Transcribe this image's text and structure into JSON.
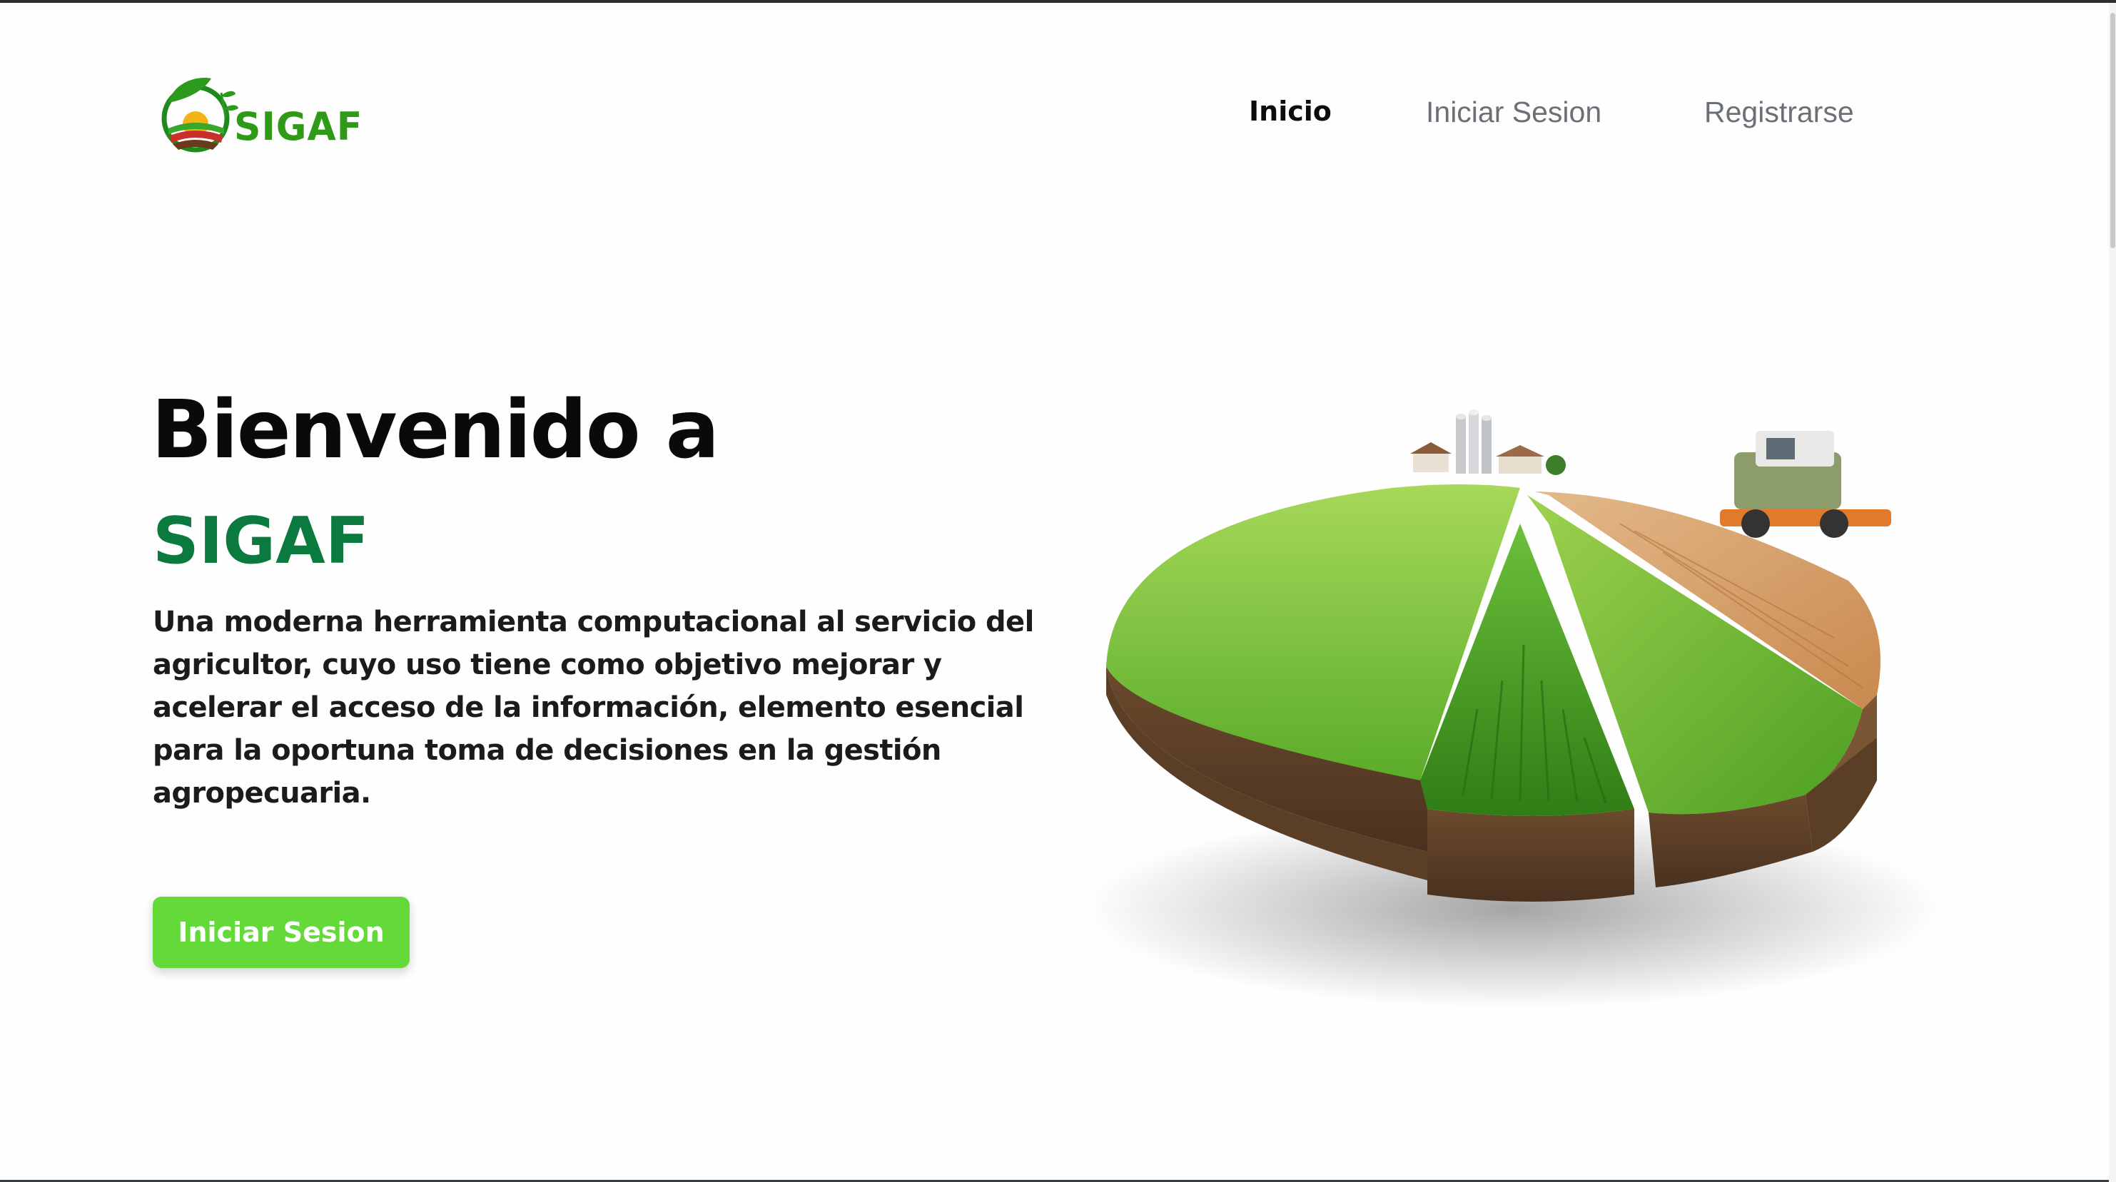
{
  "header": {
    "logo_text": "SIGAF",
    "nav": [
      {
        "label": "Inicio",
        "active": true
      },
      {
        "label": "Iniciar Sesion",
        "active": false
      },
      {
        "label": "Registrarse",
        "active": false
      }
    ]
  },
  "hero": {
    "title": "Bienvenido a",
    "brand": "SIGAF",
    "description": "Una moderna herramienta computacional al servicio del agricultor, cuyo uso tiene como objetivo mejorar y acelerar el acceso de la información, elemento esencial para la oportuna toma de decisiones en la gestión agropecuaria.",
    "cta_label": "Iniciar Sesion"
  },
  "colors": {
    "brand_green": "#0b7a3e",
    "logo_green": "#2f9a18",
    "button_green": "#63d93a",
    "nav_inactive": "#6b7076",
    "nav_active": "#0c0c0c"
  },
  "icons": {
    "logo": "leaf-sun-field-logo-icon",
    "illustration": "pie-chart-farmland-illustration"
  }
}
